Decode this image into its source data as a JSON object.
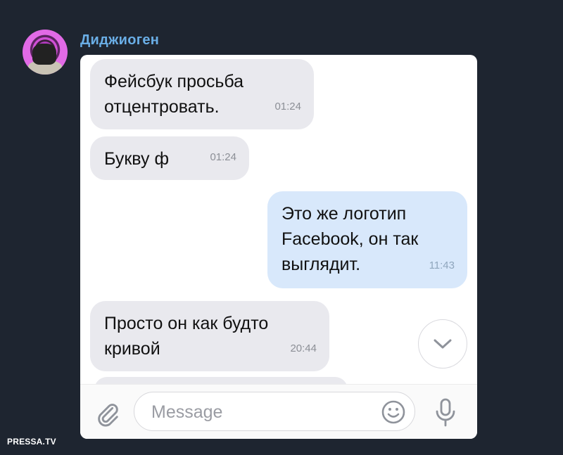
{
  "chat": {
    "sender_name": "Диджиоген",
    "messages": [
      {
        "direction": "in",
        "lines": [
          "Фейсбук просьба",
          "отцентровать."
        ],
        "time": "01:24"
      },
      {
        "direction": "in",
        "lines": [
          "Букву ф"
        ],
        "time": "01:24"
      },
      {
        "direction": "out",
        "lines": [
          "Это же логотип",
          "Facebook, он так",
          "выглядит."
        ],
        "time": "11:43"
      },
      {
        "direction": "in",
        "lines": [
          "Просто он как будто",
          "кривой"
        ],
        "time": "20:44"
      }
    ]
  },
  "composer": {
    "placeholder": "Message"
  },
  "icons": {
    "attach": "paperclip-icon",
    "emoji": "smiley-icon",
    "voice": "microphone-icon",
    "scroll": "chevron-down-icon"
  },
  "colors": {
    "background": "#1e2530",
    "sender": "#6aaee6",
    "incoming_bubble": "#e9e9ee",
    "outgoing_bubble": "#d8e8fb"
  },
  "watermark": "PRESSA.TV"
}
